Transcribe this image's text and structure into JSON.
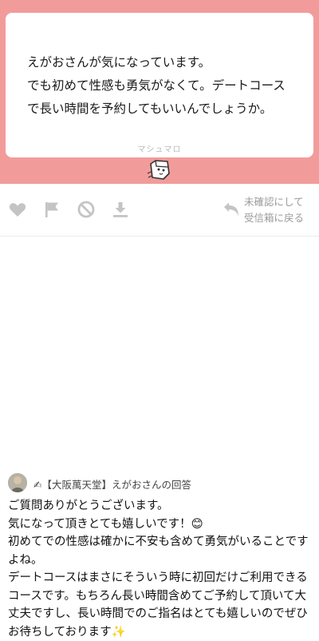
{
  "question": {
    "text": "えがおさんが気になっています。\nでも初めて性感も勇気がなくて。デートコース\nで長い時間を予約してもいいんでしょうか。",
    "brand": "マシュマロ"
  },
  "actions": {
    "return_label": "未確認にして\n受信箱に戻る"
  },
  "answer": {
    "header_icon": "✍",
    "header": "【大阪萬天堂】えがおさんの回答",
    "lines": [
      "ご質問ありがとうございます。",
      "気になって頂きとても嬉しいです！😊",
      "初めてでの性感は確かに不安も含めて勇気がいることですよね。",
      "デートコースはまさにそういう時に初回だけご利用できるコースです。もちろん長い時間含めてご予約して頂いて大丈夫ですし、長い時間でのご指名はとても嬉しいのでぜひお待ちしております✨"
    ]
  },
  "colors": {
    "banner": "#f19c9a",
    "icon": "#c4c4c4"
  }
}
